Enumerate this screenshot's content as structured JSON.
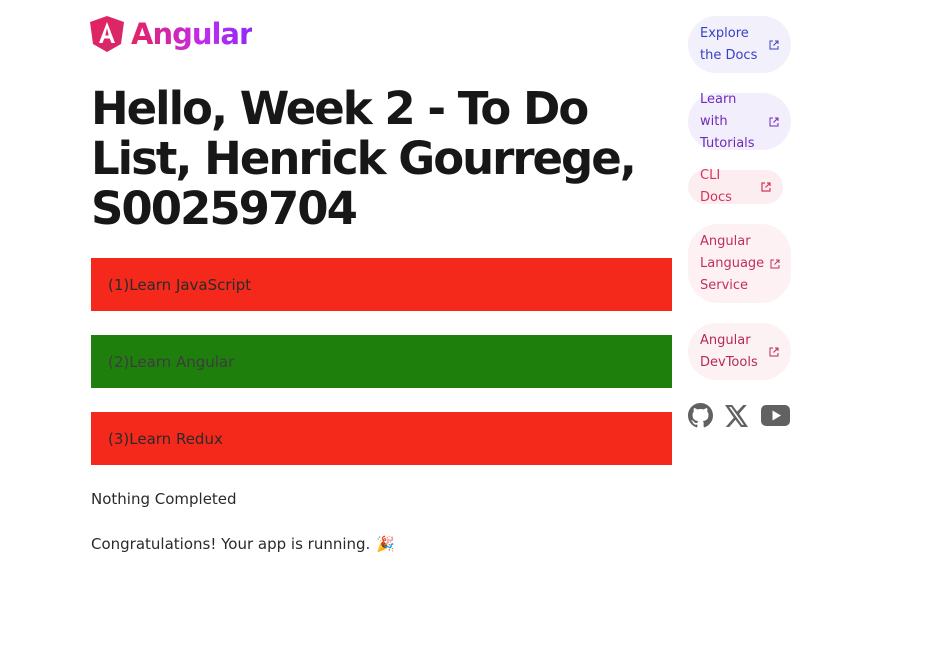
{
  "logo": {
    "text": "Angular"
  },
  "title": "Hello, Week 2 - To Do List, Henrick Gourrege, S00259704",
  "todos": [
    {
      "label": "(1)Learn JavaScript",
      "status": "red"
    },
    {
      "label": "(2)Learn Angular",
      "status": "green"
    },
    {
      "label": "(3)Learn Redux",
      "status": "red"
    }
  ],
  "status_text": "Nothing Completed",
  "congrats_text": "Congratulations! Your app is running.",
  "congrats_emoji": "🎉",
  "links": [
    {
      "label": "Explore the Docs",
      "color": "#3a3fc7"
    },
    {
      "label": "Learn with Tutorials",
      "color": "#6e2bb8"
    },
    {
      "label": "CLI Docs",
      "color": "#d3345a"
    },
    {
      "label": "Angular Language Service",
      "color": "#c0305c"
    },
    {
      "label": "Angular DevTools",
      "color": "#b6295a"
    }
  ],
  "social_icons": [
    "github-icon",
    "x-icon",
    "youtube-icon"
  ],
  "colors": {
    "todo_red": "#f5291b",
    "todo_green": "#1f7f0d",
    "brand_pink": "#e4235f",
    "brand_purple": "#c22bf0"
  }
}
